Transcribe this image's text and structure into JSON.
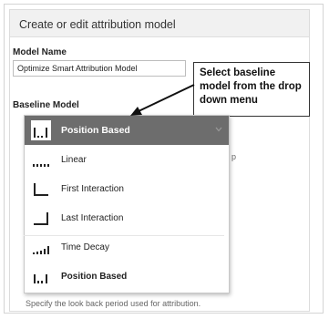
{
  "dialog": {
    "title": "Create or edit attribution model"
  },
  "form": {
    "model_name_label": "Model Name",
    "model_name_value": "Optimize Smart Attribution Model",
    "baseline_label": "Baseline Model"
  },
  "callout": {
    "text": "Select baseline model from the drop down menu"
  },
  "dropdown": {
    "selected": {
      "label": "Position Based",
      "icon": "position-based-icon"
    },
    "items": [
      {
        "label": "Linear",
        "icon": "linear-icon"
      },
      {
        "label": "First Interaction",
        "icon": "first-interaction-icon"
      },
      {
        "label": "Last Interaction",
        "icon": "last-interaction-icon"
      },
      {
        "label": "Time Decay",
        "icon": "time-decay-icon"
      },
      {
        "label": "Position Based",
        "icon": "position-based-icon"
      }
    ]
  },
  "background": {
    "partial_char": "p",
    "lookback_hint": "Specify the look back period used for attribution."
  },
  "colors": {
    "selected_bg": "#6d6d6d",
    "icon_bar": "#222222"
  }
}
